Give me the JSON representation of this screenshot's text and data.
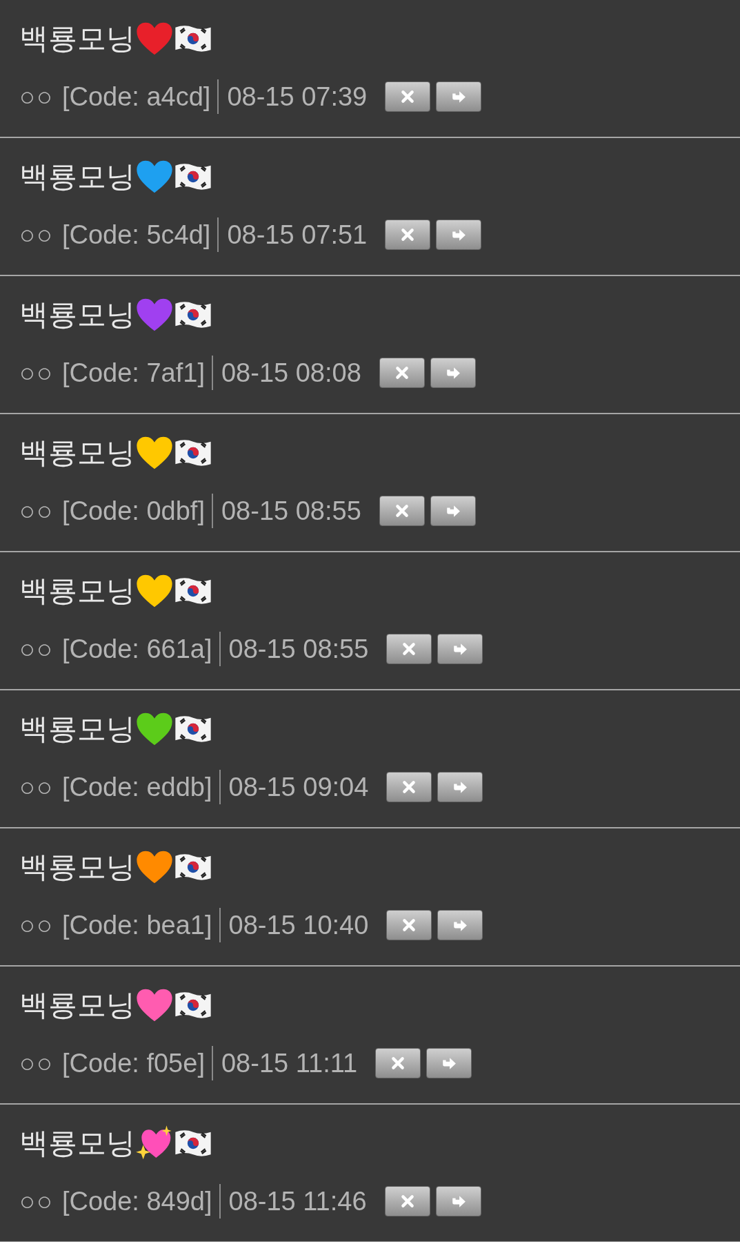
{
  "comments": [
    {
      "author": "백룡모닝",
      "emoji": {
        "kind": "heart",
        "color": "#e8202a"
      },
      "user": "○○",
      "code": "[Code: a4cd]",
      "time": "08-15 07:39"
    },
    {
      "author": "백룡모닝",
      "emoji": {
        "kind": "heart",
        "color": "#1ea0f0"
      },
      "user": "○○",
      "code": "[Code: 5c4d]",
      "time": "08-15 07:51"
    },
    {
      "author": "백룡모닝",
      "emoji": {
        "kind": "heart",
        "color": "#a040f0"
      },
      "user": "○○",
      "code": "[Code: 7af1]",
      "time": "08-15 08:08"
    },
    {
      "author": "백룡모닝",
      "emoji": {
        "kind": "heart",
        "color": "#ffc800"
      },
      "user": "○○",
      "code": "[Code: 0dbf]",
      "time": "08-15 08:55"
    },
    {
      "author": "백룡모닝",
      "emoji": {
        "kind": "heart",
        "color": "#ffc800"
      },
      "user": "○○",
      "code": "[Code: 661a]",
      "time": "08-15 08:55"
    },
    {
      "author": "백룡모닝",
      "emoji": {
        "kind": "heart",
        "color": "#5ccc1a"
      },
      "user": "○○",
      "code": "[Code: eddb]",
      "time": "08-15 09:04"
    },
    {
      "author": "백룡모닝",
      "emoji": {
        "kind": "heart",
        "color": "#ff8a00"
      },
      "user": "○○",
      "code": "[Code: bea1]",
      "time": "08-15 10:40"
    },
    {
      "author": "백룡모닝",
      "emoji": {
        "kind": "heart",
        "color": "#ff5cb0"
      },
      "user": "○○",
      "code": "[Code: f05e]",
      "time": "08-15 11:11"
    },
    {
      "author": "백룡모닝",
      "emoji": {
        "kind": "sparkling",
        "color": "#ff4fb8"
      },
      "user": "○○",
      "code": "[Code: 849d]",
      "time": "08-15 11:46"
    }
  ]
}
